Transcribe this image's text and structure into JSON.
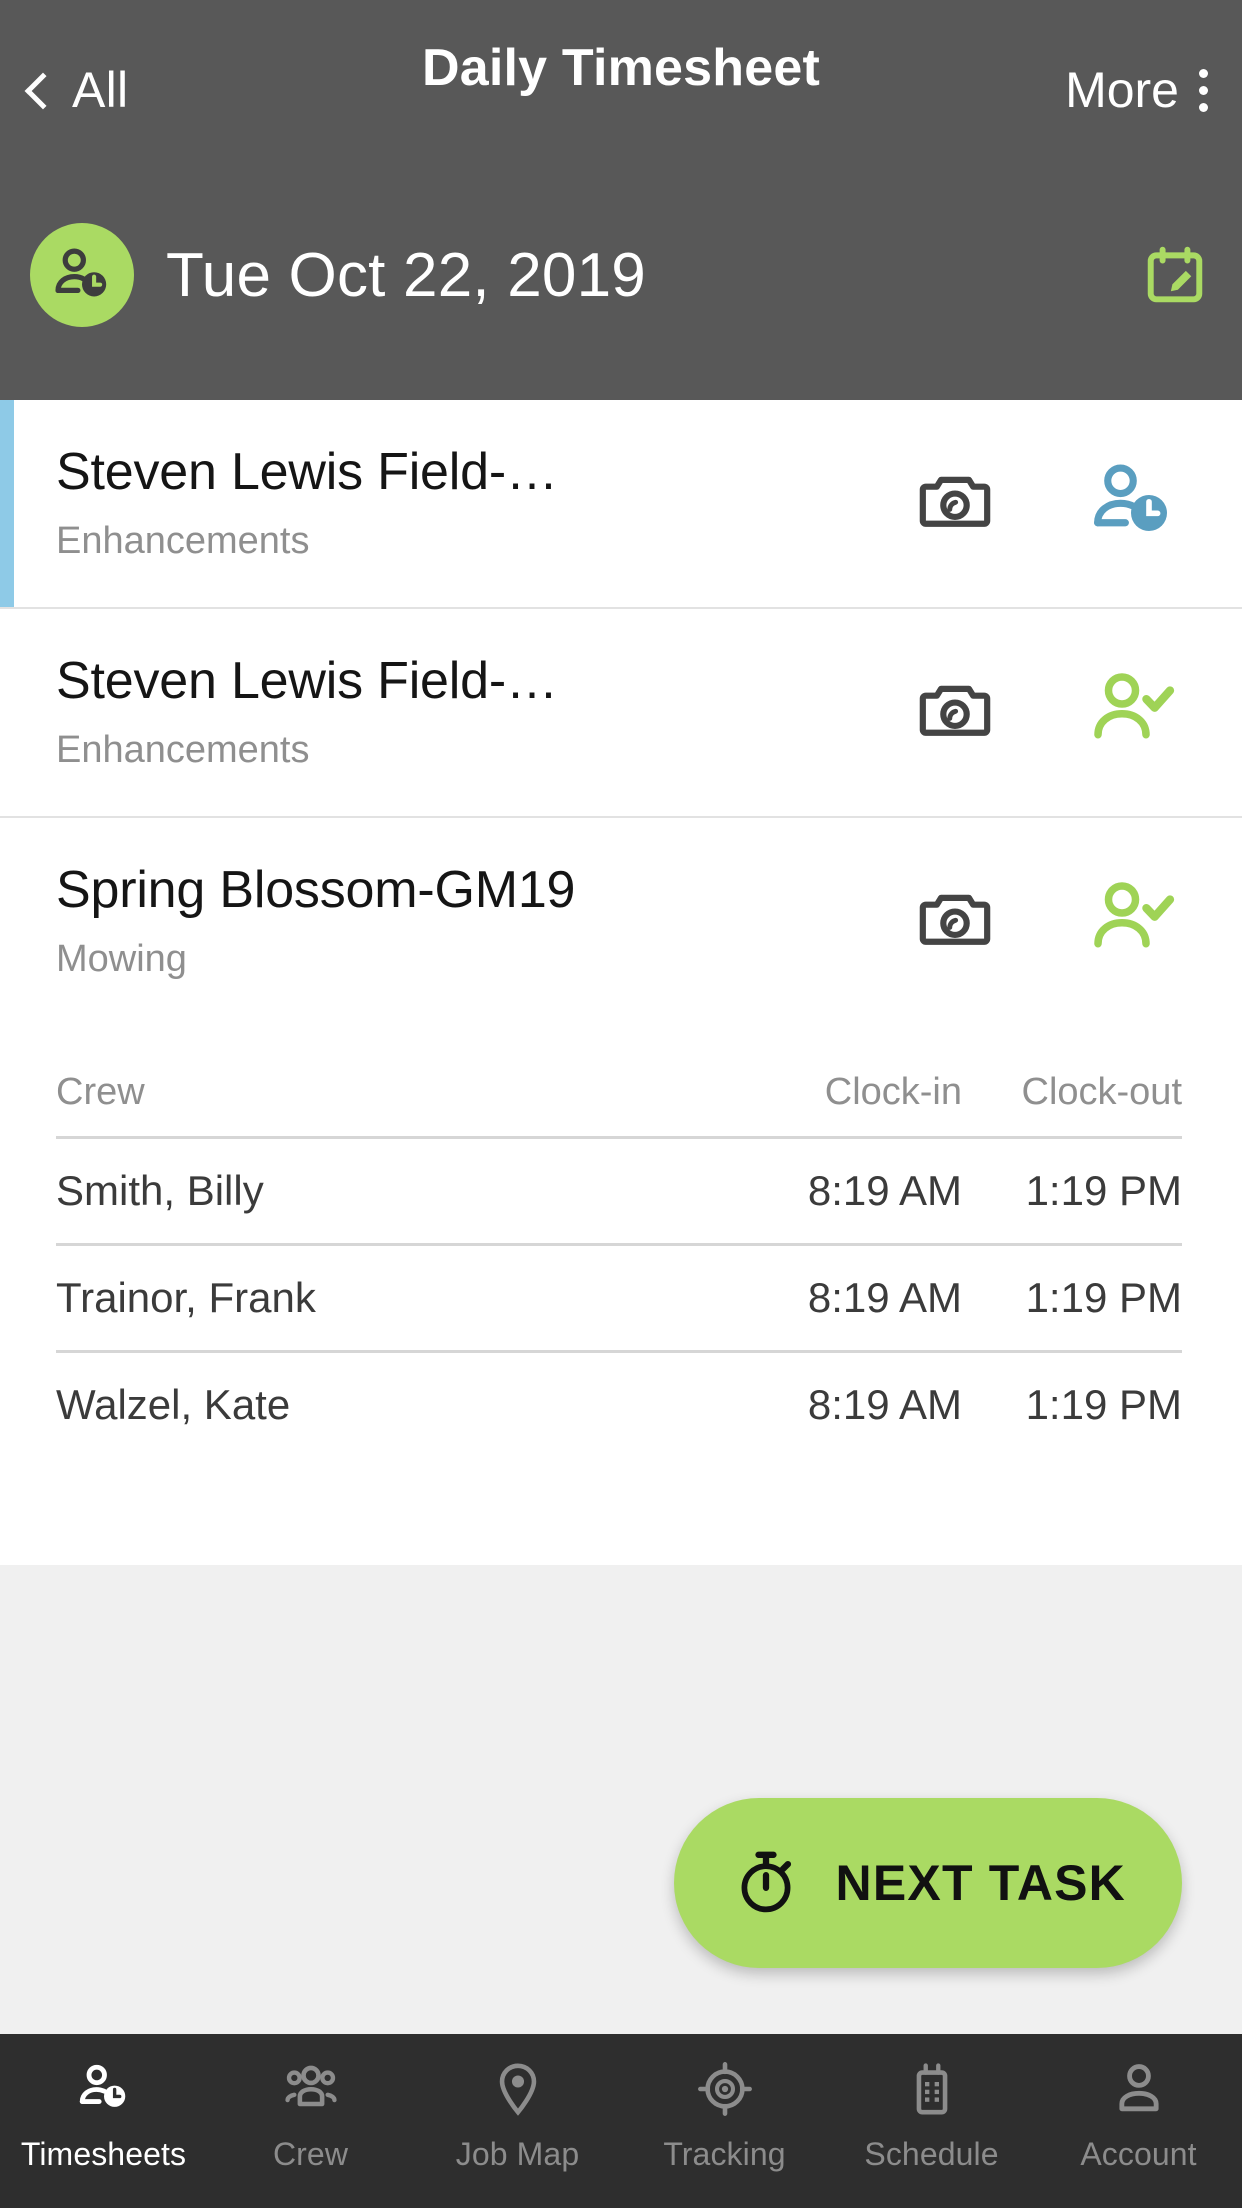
{
  "header": {
    "back_label": "All",
    "back_icon": "chevron-left-icon",
    "title": "Daily Timesheet",
    "more_label": "More",
    "more_icon": "kebab-menu-icon",
    "date": "Tue Oct 22, 2019",
    "date_avatar_icon": "person-clock-icon",
    "edit_date_icon": "calendar-edit-icon",
    "bg_color": "#585858",
    "accent_green": "#aada63"
  },
  "tasks": [
    {
      "title": "Steven Lewis Field-…",
      "subtitle": "Enhancements",
      "camera_icon": "camera-icon",
      "status_icon": "person-clock-icon",
      "status_color": "#5a9ec0",
      "active": true
    },
    {
      "title": "Steven Lewis Field-…",
      "subtitle": "Enhancements",
      "camera_icon": "camera-icon",
      "status_icon": "person-check-icon",
      "status_color": "#9fd356",
      "active": false
    },
    {
      "title": "Spring Blossom-GM19",
      "subtitle": "Mowing",
      "camera_icon": "camera-icon",
      "status_icon": "person-check-icon",
      "status_color": "#9fd356",
      "active": false
    }
  ],
  "crew_table": {
    "columns": [
      "Crew",
      "Clock-in",
      "Clock-out"
    ],
    "rows": [
      {
        "name": "Smith, Billy",
        "clock_in": "8:19 AM",
        "clock_out": "1:19 PM"
      },
      {
        "name": "Trainor, Frank",
        "clock_in": "8:19 AM",
        "clock_out": "1:19 PM"
      },
      {
        "name": "Walzel, Kate",
        "clock_in": "8:19 AM",
        "clock_out": "1:19 PM"
      }
    ]
  },
  "fab": {
    "label": "NEXT TASK",
    "icon": "stopwatch-icon",
    "color": "#aada63"
  },
  "bottom_nav": {
    "items": [
      {
        "label": "Timesheets",
        "icon": "person-clock-icon",
        "active": true
      },
      {
        "label": "Crew",
        "icon": "people-group-icon",
        "active": false
      },
      {
        "label": "Job Map",
        "icon": "map-pin-icon",
        "active": false
      },
      {
        "label": "Tracking",
        "icon": "crosshair-icon",
        "active": false
      },
      {
        "label": "Schedule",
        "icon": "radio-device-icon",
        "active": false
      },
      {
        "label": "Account",
        "icon": "person-icon",
        "active": false
      }
    ]
  }
}
